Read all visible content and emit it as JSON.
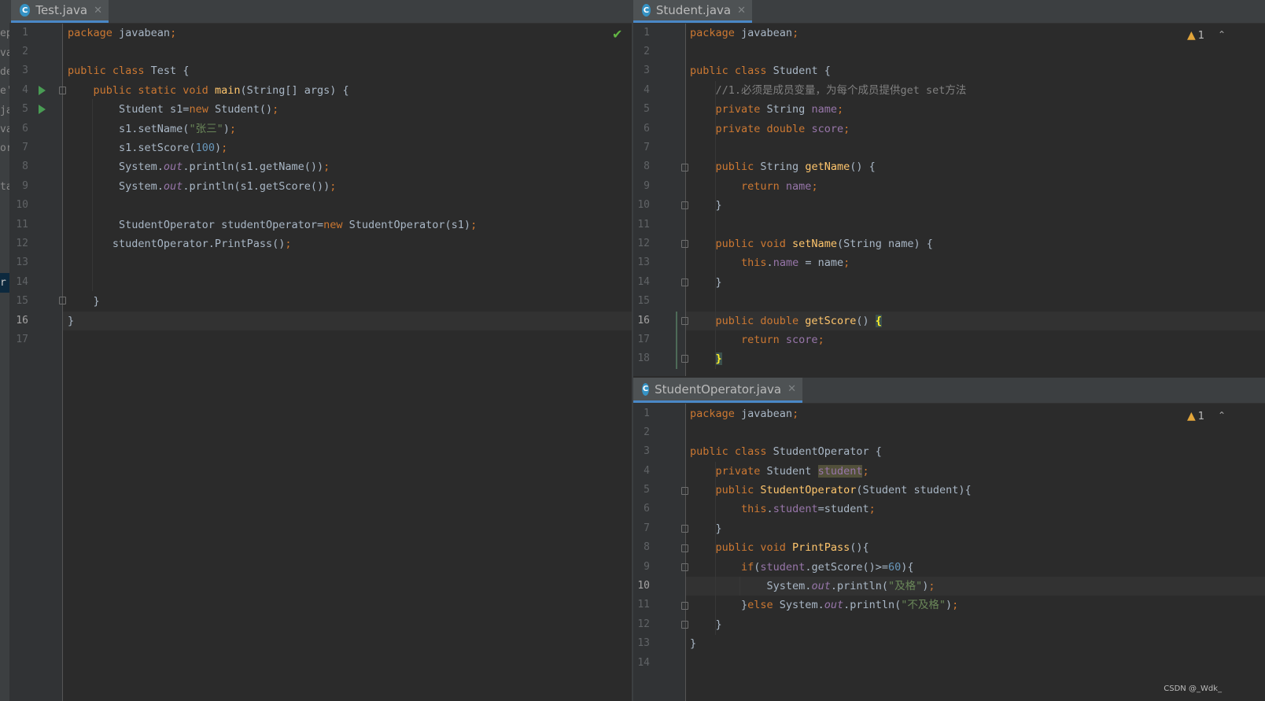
{
  "left_strip": [
    "ep",
    "va",
    "de",
    "e'",
    "ja",
    "va",
    "or",
    "",
    "ta",
    "",
    "",
    "",
    "",
    "r"
  ],
  "left_editor": {
    "tab_label": "Test.java",
    "close_glyph": "✕",
    "current_line": 16,
    "line_numbers": [
      "1",
      "2",
      "3",
      "4",
      "5",
      "6",
      "7",
      "8",
      "9",
      "10",
      "11",
      "12",
      "13",
      "14",
      "15",
      "16",
      "17"
    ],
    "lines": {
      "l1a": "package",
      "l1b": " javabean",
      "l1c": ";",
      "l3a": "public class",
      "l3b": " Test {",
      "l4a": "    public static void",
      "l4b": " main",
      "l4c": "(String[] args) {",
      "l5a": "        Student s1=",
      "l5b": "new",
      "l5c": " Student()",
      "l5d": ";",
      "l6a": "        s1.setName(",
      "l6b": "\"张三\"",
      "l6c": ")",
      "l6d": ";",
      "l7a": "        s1.setScore(",
      "l7b": "100",
      "l7c": ")",
      "l7d": ";",
      "l8a": "        System.",
      "l8b": "out",
      "l8c": ".println(s1.getName())",
      "l8d": ";",
      "l9a": "        System.",
      "l9b": "out",
      "l9c": ".println(s1.getScore())",
      "l9d": ";",
      "l11a": "        StudentOperator studentOperator=",
      "l11b": "new",
      "l11c": " StudentOperator(s1)",
      "l11d": ";",
      "l12a": "       studentOperator.PrintPass()",
      "l12b": ";",
      "l15": "    }",
      "l16": "}"
    }
  },
  "student_editor": {
    "tab_label": "Student.java",
    "close_glyph": "✕",
    "warning_count": "1",
    "current_line": 16,
    "line_numbers": [
      "1",
      "2",
      "3",
      "4",
      "5",
      "6",
      "7",
      "8",
      "9",
      "10",
      "11",
      "12",
      "13",
      "14",
      "15",
      "16",
      "17",
      "18"
    ],
    "lines": {
      "l1a": "package",
      "l1b": " javabean",
      "l1c": ";",
      "l3a": "public class",
      "l3b": " Student {",
      "l4": "    //1.必须是成员变量，为每个成员提供get set方法",
      "l5a": "    private",
      "l5b": " String ",
      "l5c": "name",
      "l5d": ";",
      "l6a": "    private double",
      "l6b": " score",
      "l6c": ";",
      "l8a": "    public",
      "l8b": " String ",
      "l8c": "getName",
      "l8d": "() {",
      "l9a": "        return",
      "l9b": " name",
      "l9c": ";",
      "l10": "    }",
      "l12a": "    public void",
      "l12b": " setName",
      "l12c": "(String name) {",
      "l13a": "        this",
      "l13b": ".",
      "l13c": "name",
      "l13d": " = name",
      "l13e": ";",
      "l14": "    }",
      "l16a": "    public double",
      "l16b": " getScore",
      "l16c": "() ",
      "l16d": "{",
      "l17a": "        return",
      "l17b": " score",
      "l17c": ";",
      "l18a": "    ",
      "l18b": "}"
    }
  },
  "operator_editor": {
    "tab_label": "StudentOperator.java",
    "close_glyph": "✕",
    "warning_count": "1",
    "current_line": 10,
    "line_numbers": [
      "1",
      "2",
      "3",
      "4",
      "5",
      "6",
      "7",
      "8",
      "9",
      "10",
      "11",
      "12",
      "13",
      "14"
    ],
    "lines": {
      "l1a": "package",
      "l1b": " javabean",
      "l1c": ";",
      "l3a": "public class",
      "l3b": " StudentOperator {",
      "l4a": "    private",
      "l4b": " Student ",
      "l4c": "student",
      "l4d": ";",
      "l5a": "    public",
      "l5b": " StudentOperator",
      "l5c": "(Student student){",
      "l6a": "        this",
      "l6b": ".",
      "l6c": "student",
      "l6d": "=student",
      "l6e": ";",
      "l7": "    }",
      "l8a": "    public void",
      "l8b": " PrintPass",
      "l8c": "(){",
      "l9a": "        if",
      "l9b": "(",
      "l9c": "student",
      "l9d": ".getScore()>=",
      "l9e": "60",
      "l9f": "){",
      "l10a": "            System.",
      "l10b": "out",
      "l10c": ".println(",
      "l10d": "\"及格\"",
      "l10e": ")",
      "l10f": ";",
      "l11a": "        }",
      "l11b": "else",
      "l11c": " System.",
      "l11d": "out",
      "l11e": ".println(",
      "l11f": "\"不及格\"",
      "l11g": ")",
      "l11h": ";",
      "l12": "    }",
      "l13": "}"
    }
  },
  "watermark": "CSDN @_Wdk_"
}
